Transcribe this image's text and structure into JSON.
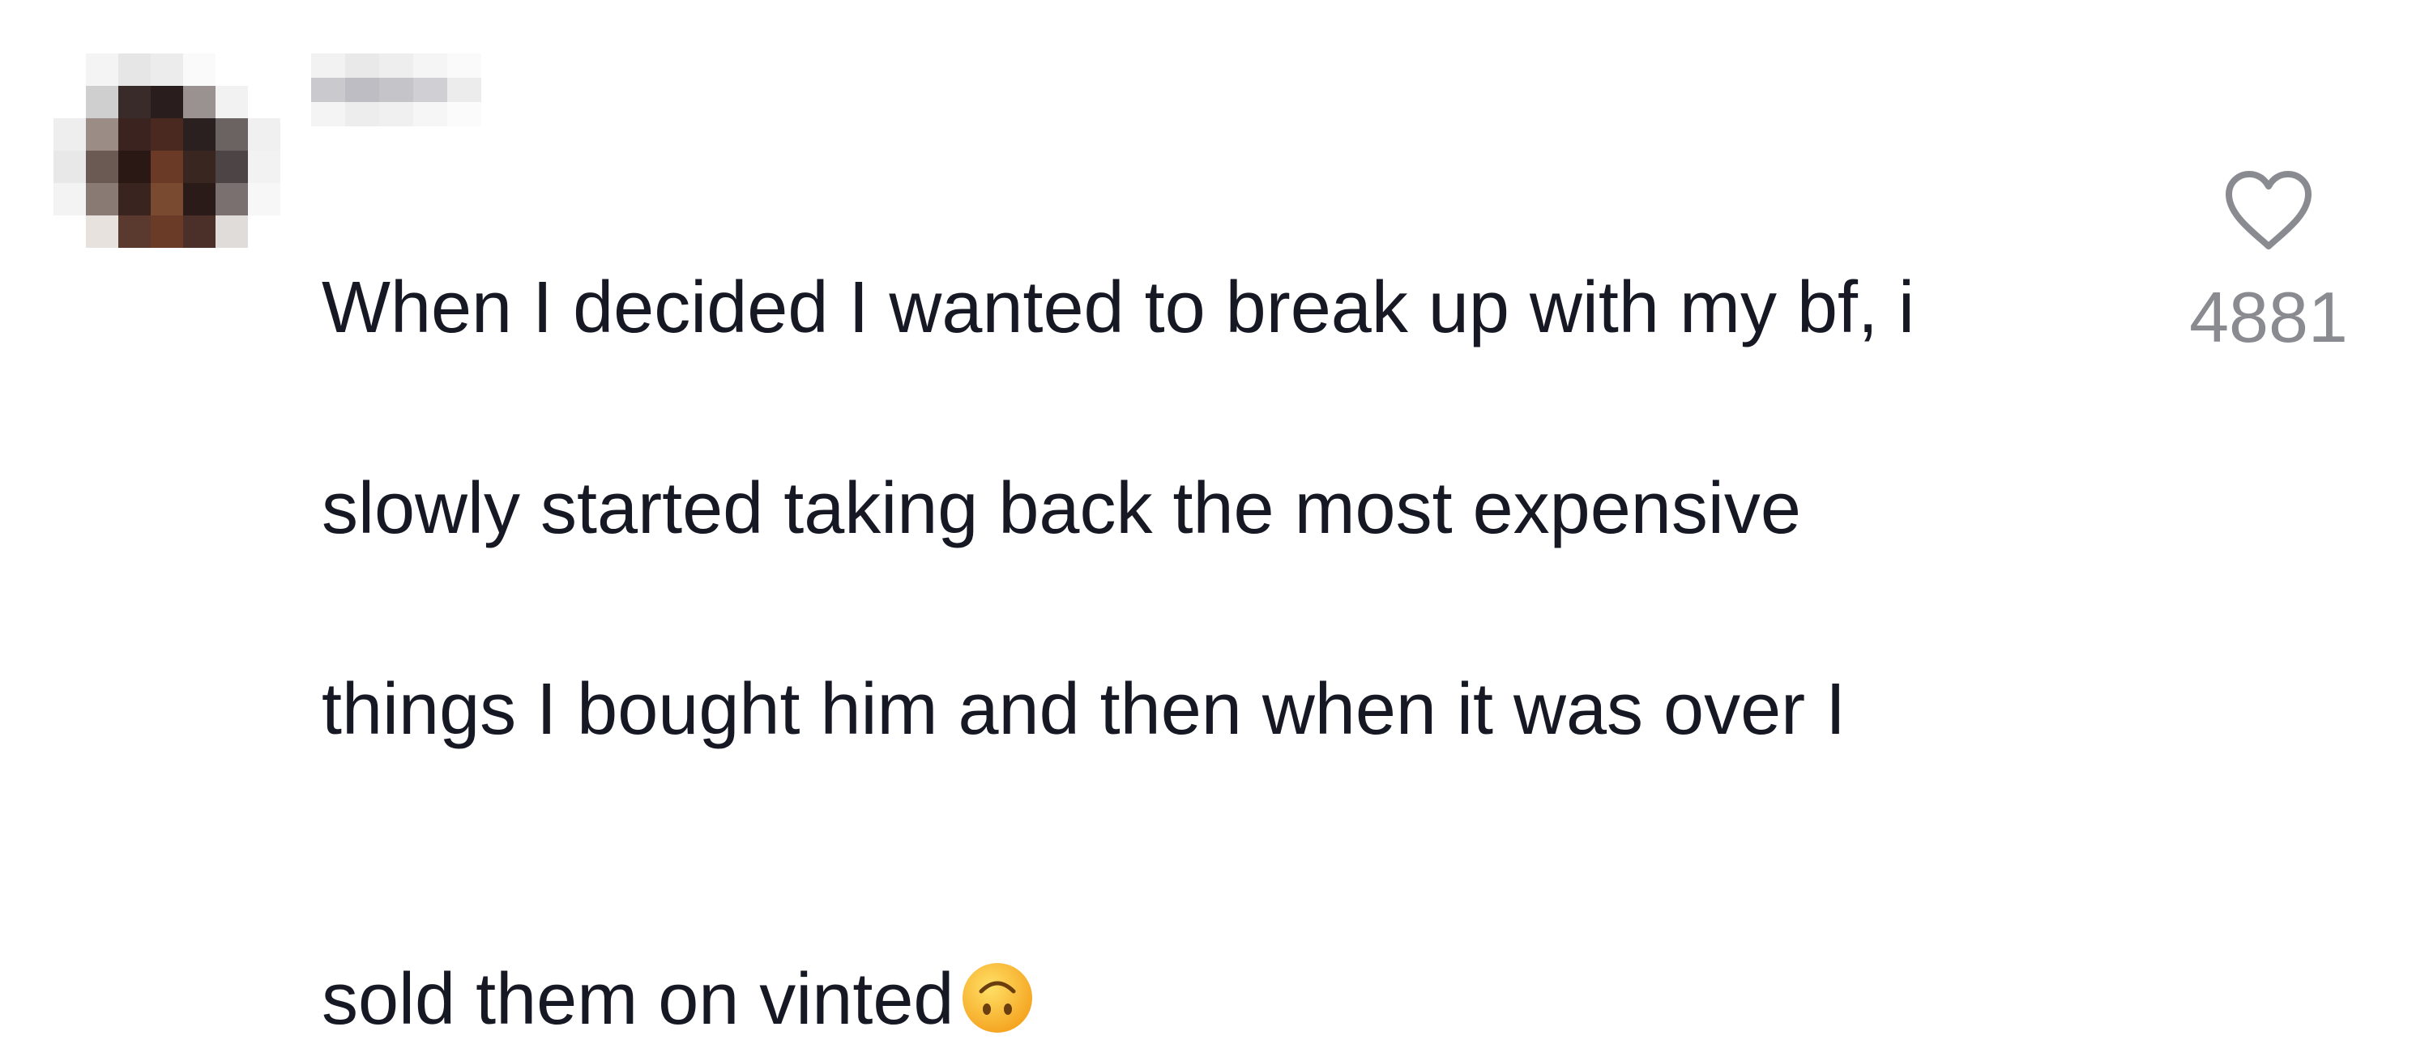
{
  "comment": {
    "text_line1": "When I decided I wanted to break up with my bf, i",
    "text_line2": "slowly started taking back the most expensive",
    "text_line3": "things I bought him and then when it was over I",
    "text_line4": "sold them on vinted",
    "emoji": "upside-down-face"
  },
  "likes": {
    "count": "4881",
    "icon": "heart-outline-icon"
  },
  "colors": {
    "text": "#161823",
    "muted": "#8a8b91",
    "heart": "#8a8b91"
  }
}
